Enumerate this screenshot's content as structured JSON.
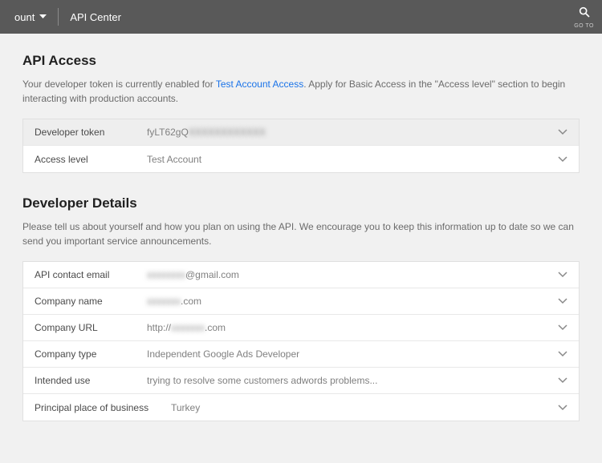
{
  "topbar": {
    "account_label": "ount",
    "page_title": "API Center",
    "search_label": "GO TO"
  },
  "api_access": {
    "title": "API Access",
    "desc_prefix": "Your developer token is currently enabled for ",
    "desc_link": "Test Account Access",
    "desc_suffix": ". Apply for Basic Access in the \"Access level\" section to begin interacting with production accounts.",
    "rows": [
      {
        "label": "Developer token",
        "value_visible": "fyLT62gQ",
        "value_blurred": "XXXXXXXXXXXX"
      },
      {
        "label": "Access level",
        "value": "Test Account"
      }
    ]
  },
  "developer_details": {
    "title": "Developer Details",
    "desc": "Please tell us about yourself and how you plan on using the API. We encourage you to keep this information up to date so we can send you important service announcements.",
    "rows": [
      {
        "label": "API contact email",
        "value_blurred": "xxxxxxxx",
        "value_suffix": "@gmail.com"
      },
      {
        "label": "Company name",
        "value_blurred": "xxxxxxx",
        "value_suffix": ".com"
      },
      {
        "label": "Company URL",
        "value_prefix": "http://",
        "value_blurred": "xxxxxxx",
        "value_suffix": ".com"
      },
      {
        "label": "Company type",
        "value": "Independent Google Ads Developer"
      },
      {
        "label": "Intended use",
        "value": "trying to resolve some customers adwords problems..."
      },
      {
        "label": "Principal place of business",
        "value": "Turkey"
      }
    ]
  }
}
